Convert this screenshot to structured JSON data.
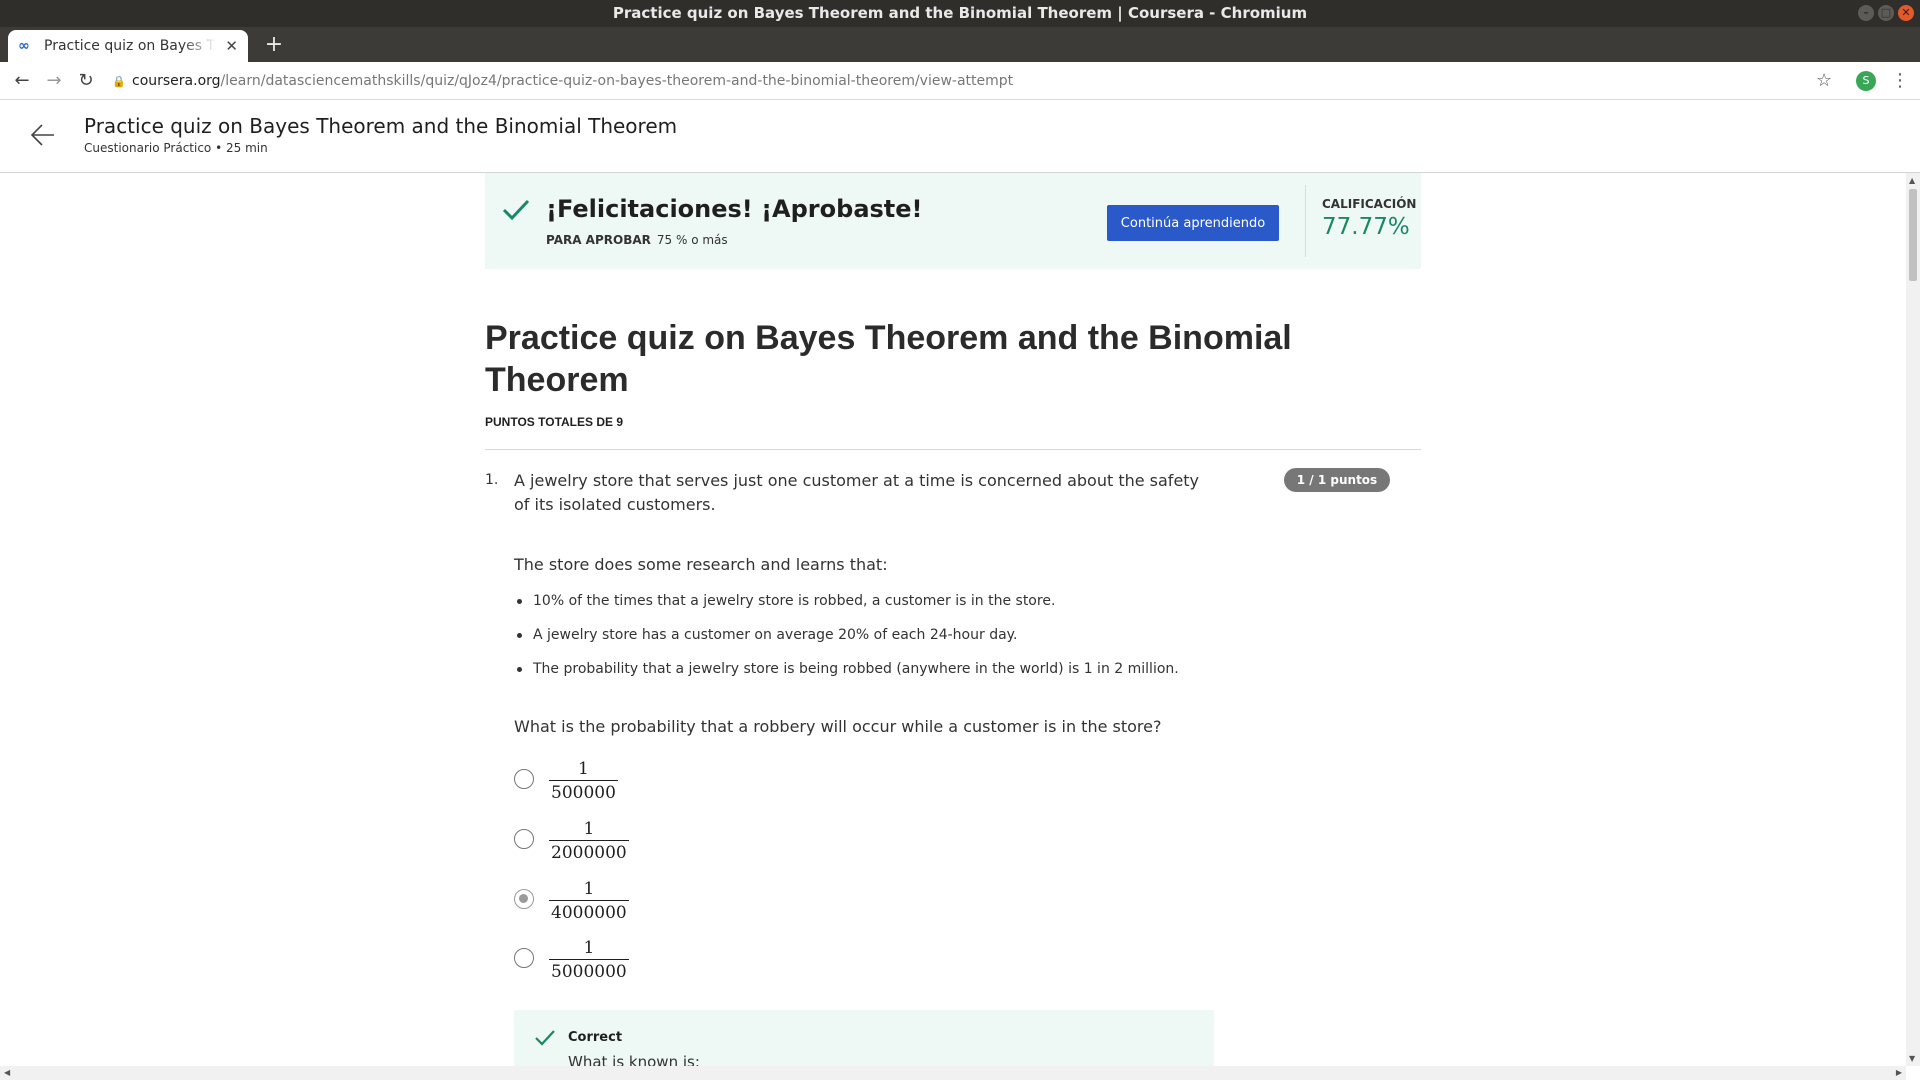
{
  "window": {
    "title": "Practice quiz on Bayes Theorem and the Binomial Theorem | Coursera - Chromium"
  },
  "browser": {
    "tab": {
      "label": "Practice quiz on Bayes Theorem and the Binomial Theorem",
      "icon": "coursera-icon"
    },
    "url_host": "coursera.org",
    "url_path": "/learn/datasciencemathskills/quiz/qJoz4/practice-quiz-on-bayes-theorem-and-the-binomial-theorem/view-attempt",
    "profile_initial": "S"
  },
  "header": {
    "title": "Practice quiz on Bayes Theorem and the Binomial Theorem",
    "subtitle": "Cuestionario Práctico • 25 min"
  },
  "banner": {
    "title": "¡Felicitaciones! ¡Aprobaste!",
    "pass_label": "PARA APROBAR",
    "pass_value": "75 % o más",
    "continue_label": "Continúa aprendiendo",
    "grade_label": "CALIFICACIÓN",
    "grade_value": "77.77%",
    "accent_color": "#1b8768"
  },
  "quiz": {
    "title": "Practice quiz on Bayes Theorem and the Binomial Theorem",
    "points_total": "PUNTOS TOTALES DE 9"
  },
  "question1": {
    "number": "1.",
    "badge": "1 / 1 puntos",
    "intro": "A jewelry store that serves just one customer at a time is concerned about the safety of its isolated customers.",
    "research": "The store does some research and learns that:",
    "facts": [
      "10% of the times that a jewelry store is robbed, a customer is in the store.",
      "A jewelry store has a customer on average 20% of each 24-hour day.",
      "The probability that a jewelry store is being robbed (anywhere in the world) is 1 in 2 million."
    ],
    "prompt": "What is the probability that a robbery will occur while a customer is in the store?",
    "options": [
      {
        "numerator": "1",
        "denominator": "500000",
        "selected": false
      },
      {
        "numerator": "1",
        "denominator": "2000000",
        "selected": false
      },
      {
        "numerator": "1",
        "denominator": "4000000",
        "selected": true
      },
      {
        "numerator": "1",
        "denominator": "5000000",
        "selected": false
      }
    ],
    "feedback": {
      "title": "Correct",
      "text": "What is known is:"
    }
  }
}
